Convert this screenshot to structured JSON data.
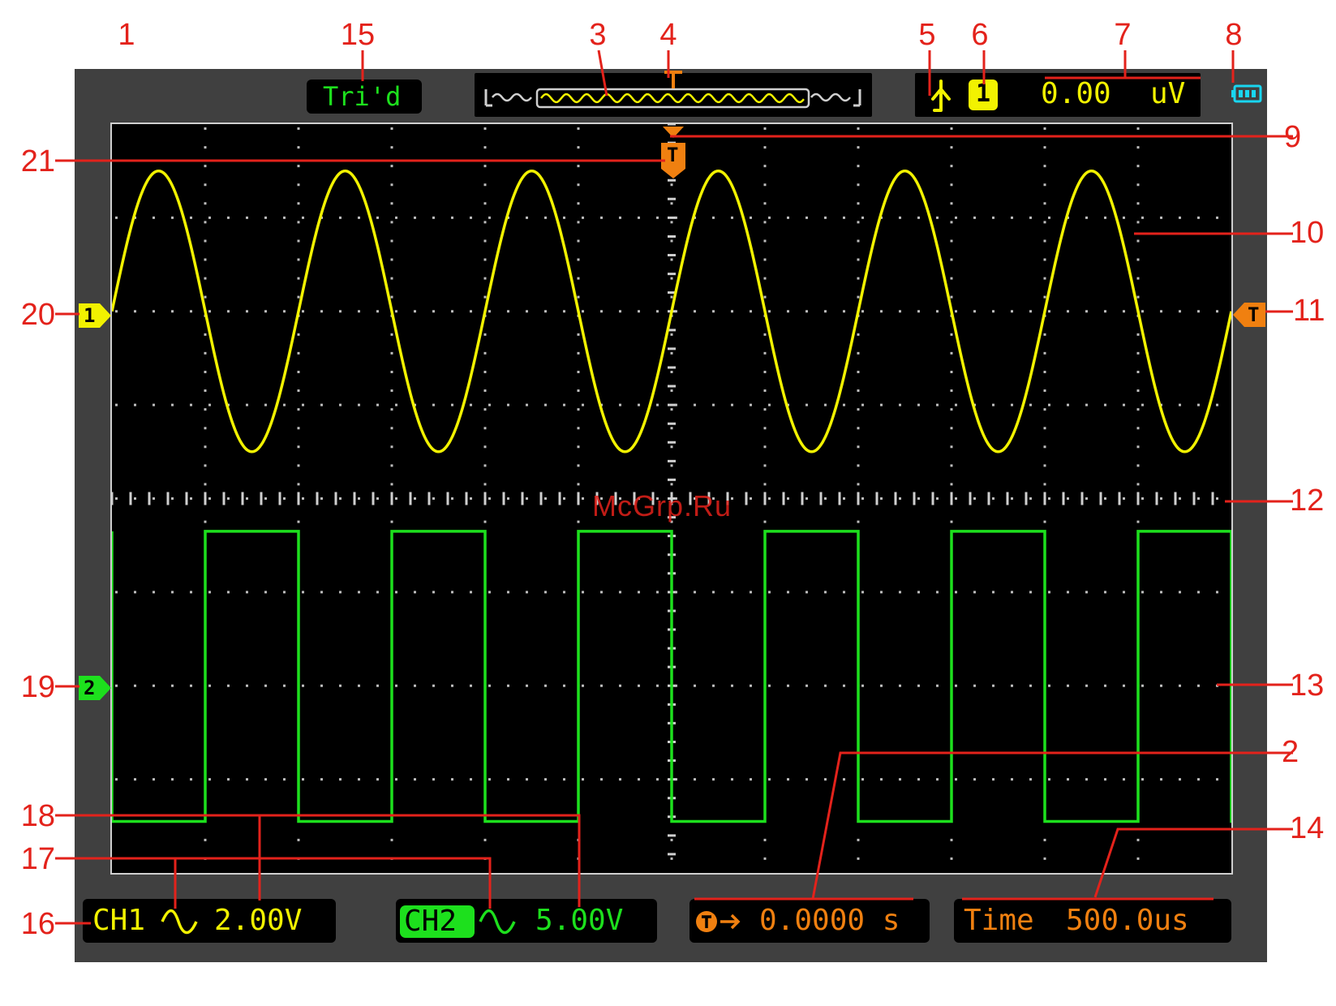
{
  "callouts": [
    {
      "id": "1",
      "label": "1"
    },
    {
      "id": "2",
      "label": "2"
    },
    {
      "id": "3",
      "label": "3"
    },
    {
      "id": "4",
      "label": "4"
    },
    {
      "id": "5",
      "label": "5"
    },
    {
      "id": "6",
      "label": "6"
    },
    {
      "id": "7",
      "label": "7"
    },
    {
      "id": "8",
      "label": "8"
    },
    {
      "id": "9",
      "label": "9"
    },
    {
      "id": "10",
      "label": "10"
    },
    {
      "id": "11",
      "label": "11"
    },
    {
      "id": "12",
      "label": "12"
    },
    {
      "id": "13",
      "label": "13"
    },
    {
      "id": "14",
      "label": "14"
    },
    {
      "id": "15",
      "label": "15"
    },
    {
      "id": "16",
      "label": "16"
    },
    {
      "id": "17",
      "label": "17"
    },
    {
      "id": "18",
      "label": "18"
    },
    {
      "id": "19",
      "label": "19"
    },
    {
      "id": "20",
      "label": "20"
    },
    {
      "id": "21",
      "label": "21"
    }
  ],
  "screen": {
    "trigger_status": "Tri'd",
    "trigger_channel": "1",
    "trigger_level_value": "0.00",
    "trigger_level_unit": "uV",
    "ch1_marker": "1",
    "ch2_marker": "2",
    "trigger_marker": "T",
    "ch1_label": "CH1",
    "ch1_scale": "2.00V",
    "ch2_label": "CH2",
    "ch2_scale": "5.00V",
    "trigger_offset_value": "0.0000 s",
    "timebase_label": "Time",
    "timebase_value": "500.0us",
    "coupling_icon": "ac-coupling-icon",
    "edge_icon": "rising-edge-icon",
    "battery_icon": "battery-icon"
  },
  "watermark": "McGrp.Ru",
  "colors": {
    "ch1": "#f2f200",
    "ch2": "#1de01d",
    "trigger": "#f08010",
    "callout": "#e3221b",
    "status_green": "#1de01d",
    "battery": "#19d6f0"
  },
  "signals": {
    "ch1_waveform": "sine",
    "ch1_periods_on_screen": 6,
    "ch2_waveform": "square",
    "ch2_periods_on_screen": 6
  }
}
